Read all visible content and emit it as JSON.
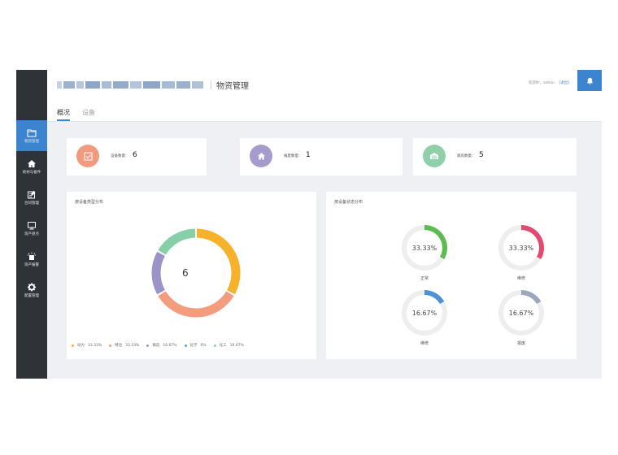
{
  "header": {
    "app_title": "物资管理",
    "user_prefix": "欢迎你，",
    "username": "admin",
    "logout_label": "[退出]"
  },
  "tabs": [
    {
      "label": "概况",
      "active": true
    },
    {
      "label": "设备",
      "active": false
    }
  ],
  "sidebar": {
    "items": [
      {
        "label": "物资管理",
        "icon": "folder-icon",
        "active": true
      },
      {
        "label": "耗材与备件",
        "icon": "home-icon",
        "active": false
      },
      {
        "label": "合同管理",
        "icon": "edit-document-icon",
        "active": false
      },
      {
        "label": "资产盘点",
        "icon": "monitor-icon",
        "active": false
      },
      {
        "label": "资产报警",
        "icon": "alarm-icon",
        "active": false
      },
      {
        "label": "配置管理",
        "icon": "gear-icon",
        "active": false
      }
    ]
  },
  "stats": [
    {
      "label": "设备数量：",
      "value": "6",
      "color": "#f09a7e",
      "icon": "checkbox-icon"
    },
    {
      "label": "报废数量：",
      "value": "1",
      "color": "#a59ccc",
      "icon": "home-icon"
    },
    {
      "label": "库房数量：",
      "value": "5",
      "color": "#8fd0ab",
      "icon": "warehouse-icon"
    }
  ],
  "type_panel": {
    "title": "按设备类型分布",
    "center_value": "6"
  },
  "status_panel": {
    "title": "按设备状态分布"
  },
  "chart_data": [
    {
      "type": "pie",
      "title": "按设备类型分布",
      "categories": [
        "动力",
        "特冶",
        "铸造",
        "化学",
        "化工"
      ],
      "values": [
        33.33,
        33.33,
        16.67,
        0,
        16.67
      ],
      "value_labels": [
        "33.33%",
        "33.33%",
        "16.67%",
        "0%",
        "16.67%"
      ],
      "colors": [
        "#f7b12b",
        "#f39c7e",
        "#9d93c8",
        "#58a8de",
        "#86cfa8"
      ],
      "center_text": "6",
      "legend_position": "bottom"
    },
    {
      "type": "pie",
      "title": "按设备状态分布",
      "categories": [
        "正常",
        "维修",
        "维修",
        "报废"
      ],
      "values": [
        33.33,
        33.33,
        16.67,
        16.67
      ],
      "value_labels": [
        "33.33%",
        "33.33%",
        "16.67%",
        "16.67%"
      ],
      "colors": [
        "#5bbb4e",
        "#e6496f",
        "#4f91d6",
        "#9ba7ba"
      ],
      "track_color": "#eeeeee"
    }
  ]
}
